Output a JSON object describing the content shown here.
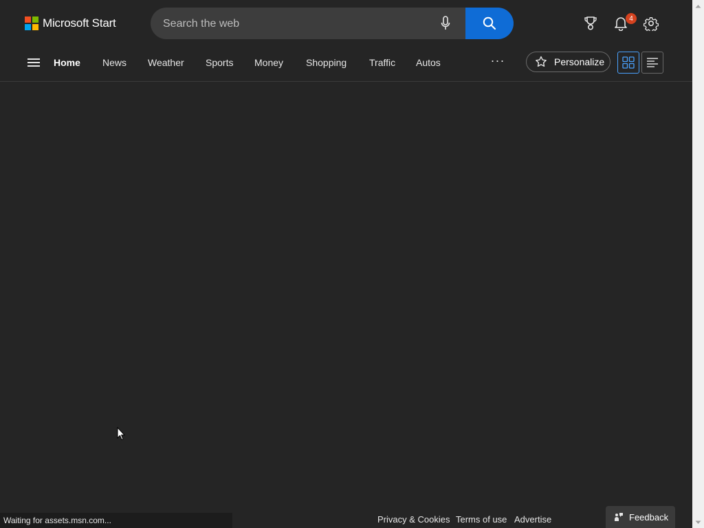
{
  "colors": {
    "background": "#252525",
    "accent": "#0f6cd6",
    "badge": "#d4421f",
    "logo_red": "#f25022",
    "logo_green": "#7fba00",
    "logo_blue": "#00a4ef",
    "logo_yellow": "#ffb900"
  },
  "header": {
    "brand": "Microsoft Start",
    "search": {
      "placeholder": "Search the web",
      "mic_icon": "microphone-icon",
      "search_icon": "search-icon"
    },
    "icons": {
      "rewards": "trophy-icon",
      "notifications": "bell-icon",
      "settings": "gear-icon"
    },
    "notification_count": "4"
  },
  "nav": {
    "menu_icon": "hamburger-icon",
    "items": [
      {
        "label": "Home",
        "active": true
      },
      {
        "label": "News"
      },
      {
        "label": "Weather"
      },
      {
        "label": "Sports"
      },
      {
        "label": "Money"
      },
      {
        "label": "Shopping"
      },
      {
        "label": "Traffic"
      },
      {
        "label": "Autos"
      }
    ],
    "more": "···",
    "personalize": "Personalize",
    "personalize_icon": "sparkle-star-icon",
    "view_grid_icon": "grid-view-icon",
    "view_list_icon": "list-view-icon"
  },
  "footer": {
    "status": "Waiting for assets.msn.com...",
    "links": [
      "Privacy & Cookies",
      "Terms of use",
      "Advertise"
    ],
    "feedback": "Feedback",
    "feedback_icon": "feedback-icon"
  }
}
